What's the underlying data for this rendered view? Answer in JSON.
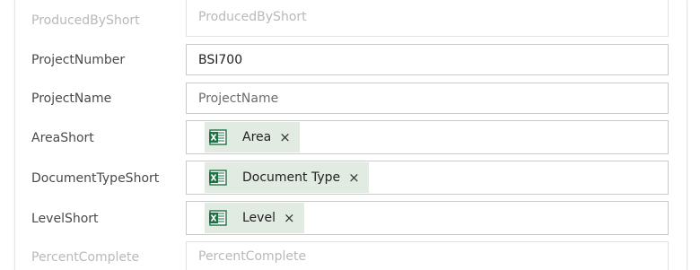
{
  "fields": [
    {
      "label": "ProducedByShort",
      "placeholder": "ProducedByShort"
    },
    {
      "label": "ProjectNumber",
      "value": "BSI700"
    },
    {
      "label": "ProjectName",
      "placeholder": "ProjectName"
    },
    {
      "label": "AreaShort",
      "tag": "Area"
    },
    {
      "label": "DocumentTypeShort",
      "tag": "Document Type"
    },
    {
      "label": "LevelShort",
      "tag": "Level"
    },
    {
      "label": "PercentComplete",
      "placeholder": "PercentComplete"
    }
  ],
  "tag_close_glyph": "×",
  "tag_icon": "excel-icon",
  "colors": {
    "tag_background": "#e1ebe2",
    "excel_green": "#1e7145"
  }
}
